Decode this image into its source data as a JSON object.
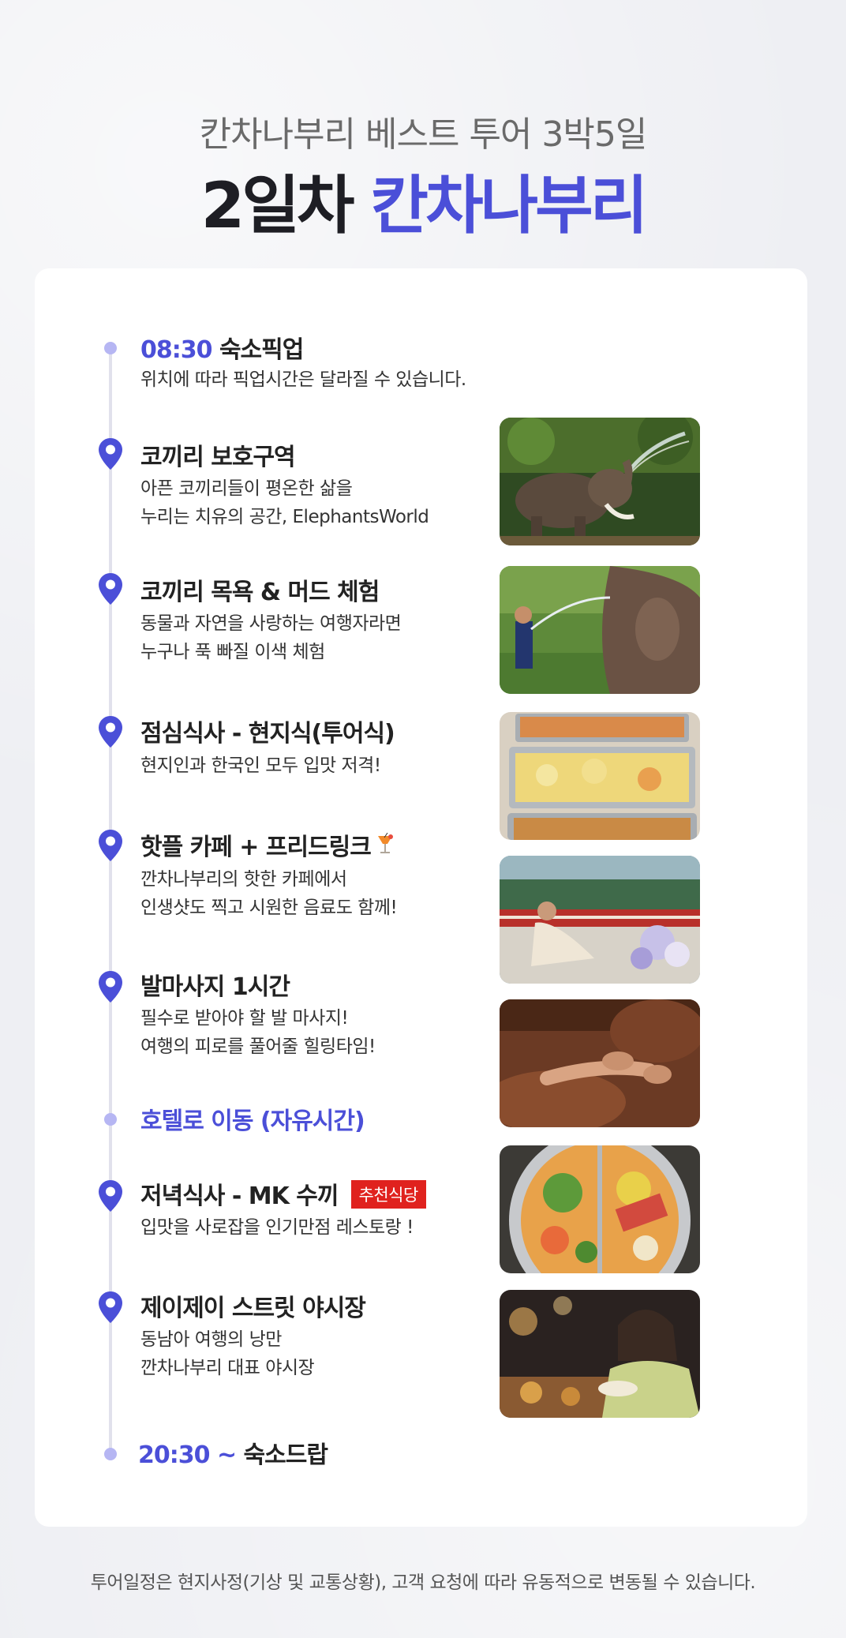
{
  "header": {
    "subtitle": "칸차나부리 베스트 투어 3박5일",
    "title_day": "2일차",
    "title_place": "칸차나부리"
  },
  "timeline": {
    "pickup": {
      "time": "08:30",
      "title": "숙소픽업",
      "desc": "위치에 따라 픽업시간은 달라질 수 있습니다."
    },
    "elephant_sanctuary": {
      "title": "코끼리 보호구역",
      "desc1": "아픈 코끼리들이 평온한 삶을",
      "desc2": "누리는 치유의 공간, ElephantsWorld",
      "photo": "elephant-spraying-water"
    },
    "elephant_bath": {
      "title": "코끼리 목욕 & 머드 체험",
      "desc1": "동물과 자연을 사랑하는 여행자라면",
      "desc2": "누구나 푹 빠질 이색 체험",
      "photo": "man-washing-elephant"
    },
    "lunch": {
      "title": "점심식사 - 현지식(투어식)",
      "desc1": "현지인과 한국인 모두 입맛 저격!",
      "photo": "buffet-trays"
    },
    "cafe": {
      "title": "핫플 카페 + 프리드링크",
      "icon": "cocktail-icon",
      "desc1": "깐차나부리의 핫한 카페에서",
      "desc2": "인생샷도 찍고 시원한 음료도 함께!",
      "photo": "cafe-by-railway"
    },
    "massage": {
      "title": "발마사지 1시간",
      "desc1": "필수로 받아야 할 발 마사지!",
      "desc2": "여행의 피로를 풀어줄 힐링타임!",
      "photo": "foot-massage"
    },
    "hotel": {
      "title": "호텔로 이동 (자유시간)"
    },
    "dinner": {
      "title": "저녁식사 - MK 수끼",
      "badge": "추천식당",
      "desc1": "입맛을 사로잡을 인기만점 레스토랑 !",
      "photo": "suki-hotpot"
    },
    "night_market": {
      "title": "제이제이 스트릿 야시장",
      "desc1": "동남아 여행의 낭만",
      "desc2": "깐차나부리 대표 야시장",
      "photo": "night-market-woman"
    },
    "dropoff": {
      "time": "20:30 ~",
      "title": "숙소드랍"
    }
  },
  "footer": {
    "note": "투어일정은 현지사정(기상 및 교통상황), 고객 요청에 따라 유동적으로 변동될 수 있습니다."
  },
  "colors": {
    "accent": "#4b4fd8",
    "dot": "#b6b6f3",
    "badge": "#e0221e"
  }
}
